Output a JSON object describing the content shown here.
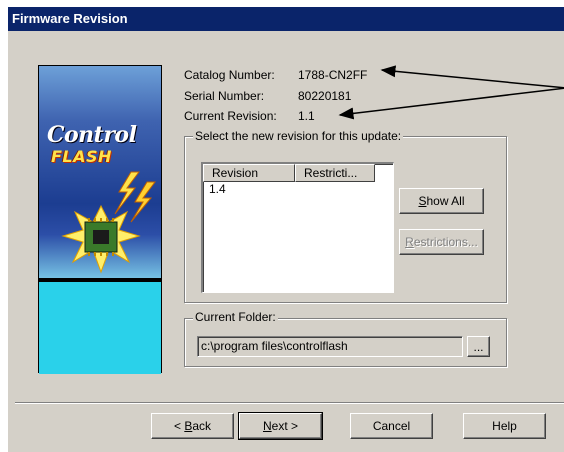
{
  "window": {
    "title": "Firmware Revision"
  },
  "logo": {
    "word1": "Control",
    "word2": "FLASH"
  },
  "info": {
    "catalog_label": "Catalog Number:",
    "catalog_value": "1788-CN2FF",
    "serial_label": "Serial Number:",
    "serial_value": "80220181",
    "revision_label": "Current Revision:",
    "revision_value": "1.1"
  },
  "revision_group": {
    "title": "Select the new revision for this update:",
    "columns": [
      "Revision",
      "Restricti..."
    ],
    "rows": [
      "1.4"
    ]
  },
  "side_buttons": {
    "show_all": "Show All",
    "restrictions": "Restrictions..."
  },
  "folder_group": {
    "title": "Current Folder:",
    "path": "c:\\program files\\controlflash",
    "browse_label": "..."
  },
  "footer_buttons": {
    "back": "< Back",
    "next": "Next >",
    "cancel": "Cancel",
    "help": "Help"
  },
  "colors": {
    "titlebar": "#0a246a",
    "dialog_face": "#d4d0c8",
    "logo_blue": "#1c3d91",
    "logo_cyan": "#2ad1ea",
    "logo_yellow": "#ffe24a"
  }
}
